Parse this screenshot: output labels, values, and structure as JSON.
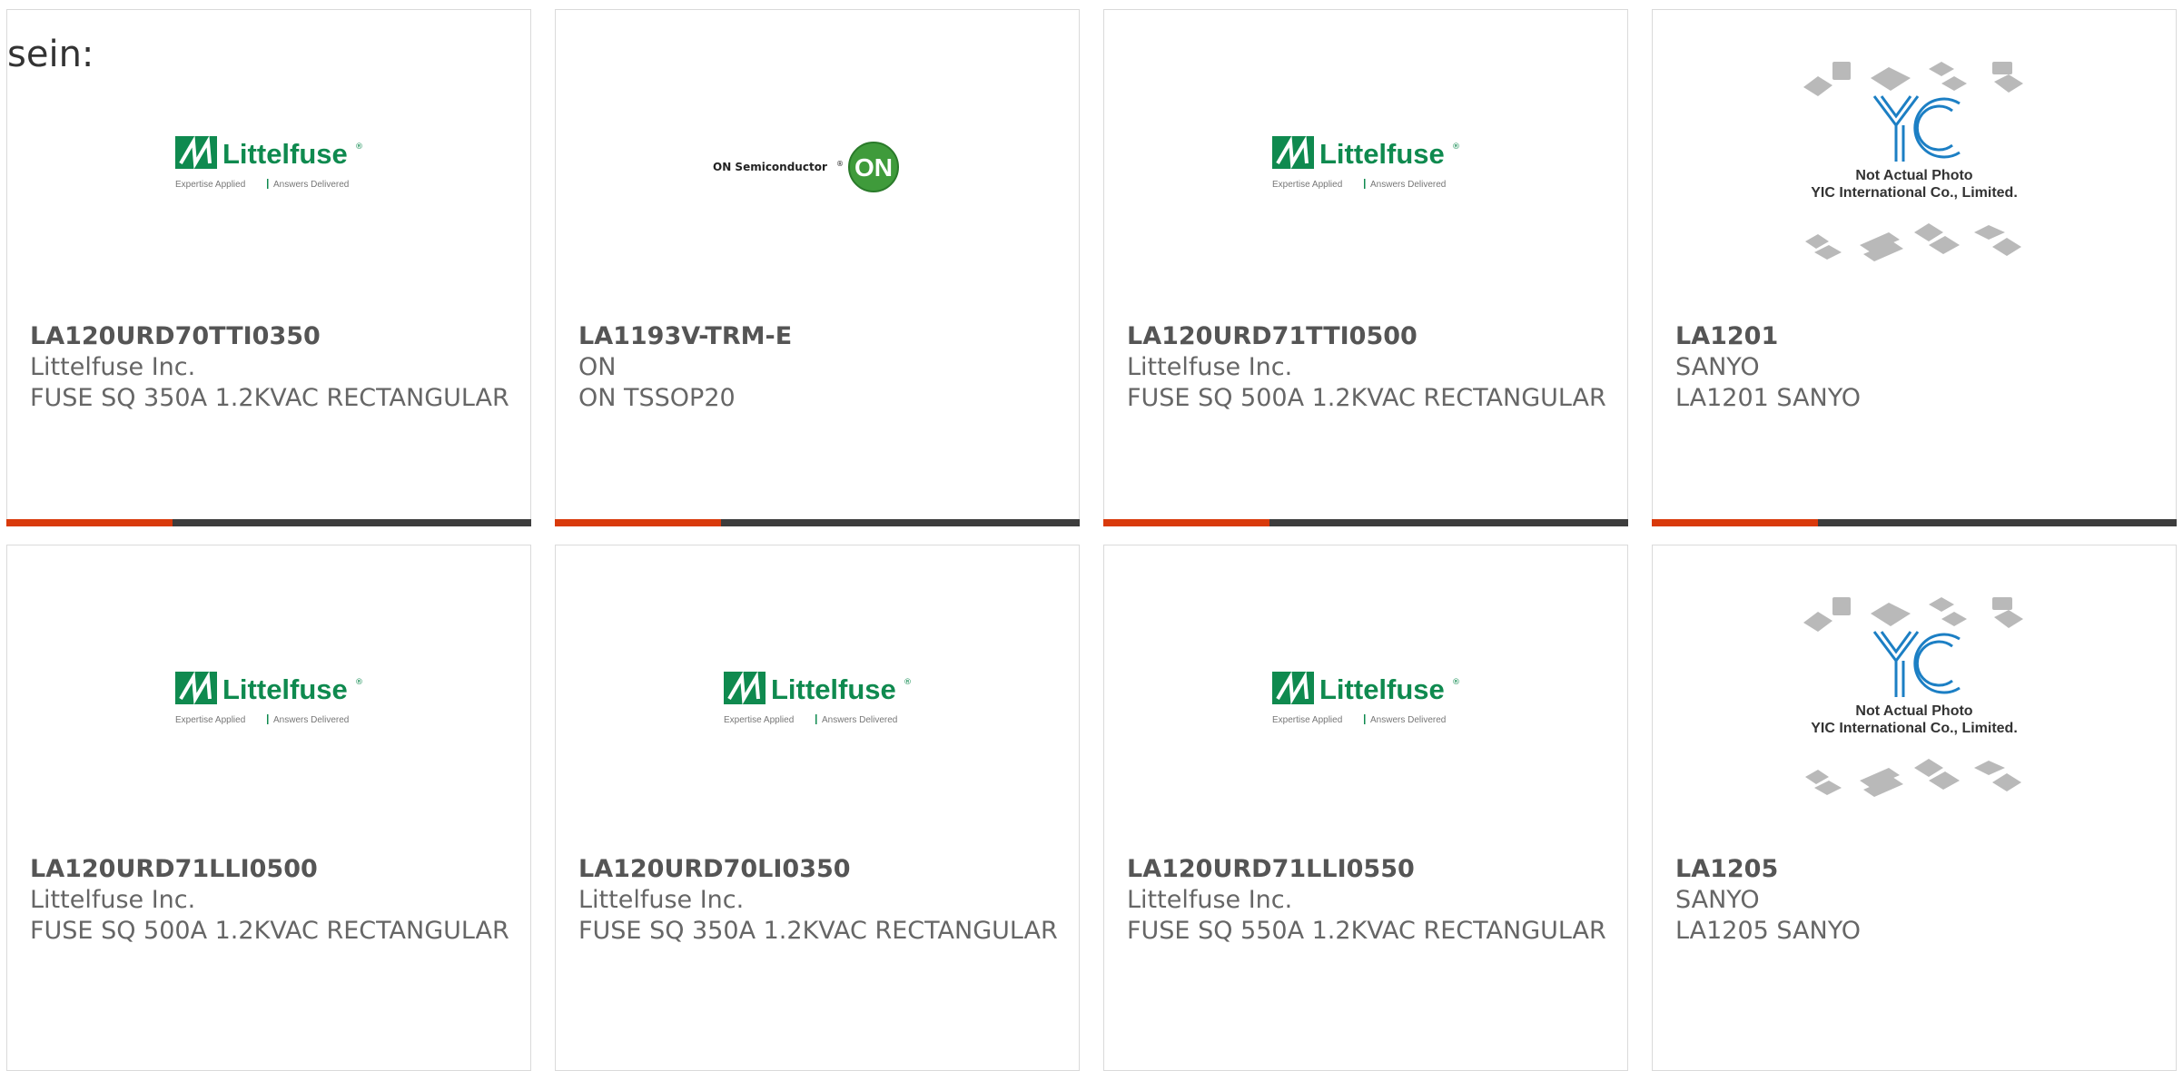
{
  "intro_text": "sein:",
  "colors": {
    "accent": "#d93a0b",
    "bar": "#3d3d3d",
    "littelfuse_green": "#0f8a4f",
    "on_green": "#3f9b3b"
  },
  "products": [
    {
      "part_number": "LA120URD70TTI0350",
      "manufacturer": "Littelfuse Inc.",
      "description": "FUSE SQ 350A 1.2KVAC RECTANGULAR",
      "logo": "littelfuse"
    },
    {
      "part_number": "LA1193V-TRM-E",
      "manufacturer": "ON",
      "description": "ON TSSOP20",
      "logo": "on-semiconductor"
    },
    {
      "part_number": "LA120URD71TTI0500",
      "manufacturer": "Littelfuse Inc.",
      "description": "FUSE SQ 500A 1.2KVAC RECTANGULAR",
      "logo": "littelfuse"
    },
    {
      "part_number": "LA1201",
      "manufacturer": "SANYO",
      "description": "LA1201 SANYO",
      "logo": "yic-placeholder"
    },
    {
      "part_number": "LA120URD71LLI0500",
      "manufacturer": "Littelfuse Inc.",
      "description": "FUSE SQ 500A 1.2KVAC RECTANGULAR",
      "logo": "littelfuse"
    },
    {
      "part_number": "LA120URD70LI0350",
      "manufacturer": "Littelfuse Inc.",
      "description": "FUSE SQ 350A 1.2KVAC RECTANGULAR",
      "logo": "littelfuse"
    },
    {
      "part_number": "LA120URD71LLI0550",
      "manufacturer": "Littelfuse Inc.",
      "description": "FUSE SQ 550A 1.2KVAC RECTANGULAR",
      "logo": "littelfuse"
    },
    {
      "part_number": "LA1205",
      "manufacturer": "SANYO",
      "description": "LA1205 SANYO",
      "logo": "yic-placeholder"
    }
  ],
  "logos": {
    "littelfuse": {
      "name": "Littelfuse",
      "registered": "®",
      "tagline_left": "Expertise Applied",
      "tagline_right": "Answers Delivered"
    },
    "on_semi": {
      "name": "ON Semiconductor",
      "registered": "®",
      "badge": "ON"
    },
    "yic": {
      "monogram": "YIC",
      "line1": "Not Actual Photo",
      "line2": "YIC International Co., Limited."
    }
  }
}
